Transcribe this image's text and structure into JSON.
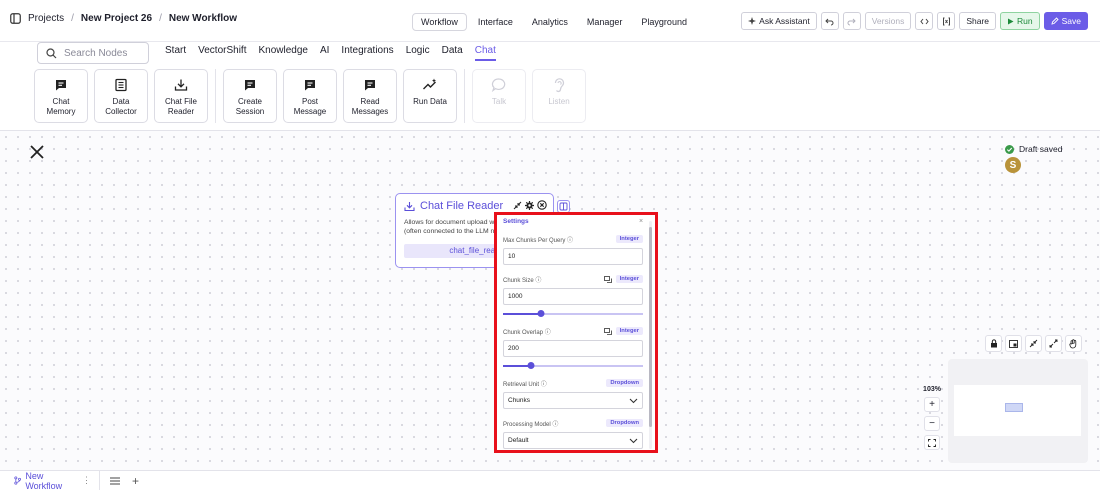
{
  "header": {
    "crumbs": [
      "Projects",
      "New Project 26",
      "New Workflow"
    ],
    "modes": [
      "Workflow",
      "Interface",
      "Analytics",
      "Manager",
      "Playground"
    ],
    "active_mode": "Workflow",
    "actions": {
      "ask_assistant": "Ask Assistant",
      "versions": "Versions",
      "share": "Share",
      "run": "Run",
      "save": "Save"
    }
  },
  "toolbar": {
    "search_placeholder": "Search Nodes",
    "categories": [
      "Start",
      "VectorShift",
      "Knowledge",
      "AI",
      "Integrations",
      "Logic",
      "Data",
      "Chat"
    ],
    "active_category": "Chat",
    "tiles": [
      {
        "line1": "Chat",
        "line2": "Memory",
        "icon": "chat-icon"
      },
      {
        "line1": "Data",
        "line2": "Collector",
        "icon": "form-icon"
      },
      {
        "line1": "Chat File",
        "line2": "Reader",
        "icon": "download-icon"
      },
      {
        "line1": "Create",
        "line2": "Session",
        "icon": "chat-icon"
      },
      {
        "line1": "Post",
        "line2": "Message",
        "icon": "chat-icon"
      },
      {
        "line1": "Read",
        "line2": "Messages",
        "icon": "chat-icon"
      },
      {
        "line1": "Run Data",
        "line2": "",
        "icon": "sparkle-line-icon"
      },
      {
        "line1": "Talk",
        "line2": "",
        "icon": "speech-bubble-icon",
        "disabled": true
      },
      {
        "line1": "Listen",
        "line2": "",
        "icon": "ear-icon",
        "disabled": true
      }
    ]
  },
  "canvas": {
    "draft_status": "Draft saved",
    "avatar_initial": "S",
    "zoom": "103%"
  },
  "node": {
    "title": "Chat File Reader",
    "description_line1": "Allows for document upload w",
    "description_line2": "(often connected to the LLM n",
    "output": "chat_file_read"
  },
  "settings": {
    "title": "Settings",
    "fields": {
      "max_chunks": {
        "label": "Max Chunks Per Query",
        "type": "Integer",
        "value": "10"
      },
      "chunk_size": {
        "label": "Chunk Size",
        "type": "Integer",
        "value": "1000",
        "slider_fraction": 0.27
      },
      "chunk_overlap": {
        "label": "Chunk Overlap",
        "type": "Integer",
        "value": "200",
        "slider_fraction": 0.2
      },
      "retrieval_unit": {
        "label": "Retrieval Unit",
        "type": "Dropdown",
        "value": "Chunks"
      },
      "processing_model": {
        "label": "Processing Model",
        "type": "Dropdown",
        "value": "Default"
      }
    }
  },
  "bottom": {
    "tab_label": "New Workflow"
  },
  "colors": {
    "accent": "#6b5ce7",
    "highlight_border": "#e8101b",
    "run_green": "#1d8a3a",
    "avatar": "#b9933a"
  }
}
